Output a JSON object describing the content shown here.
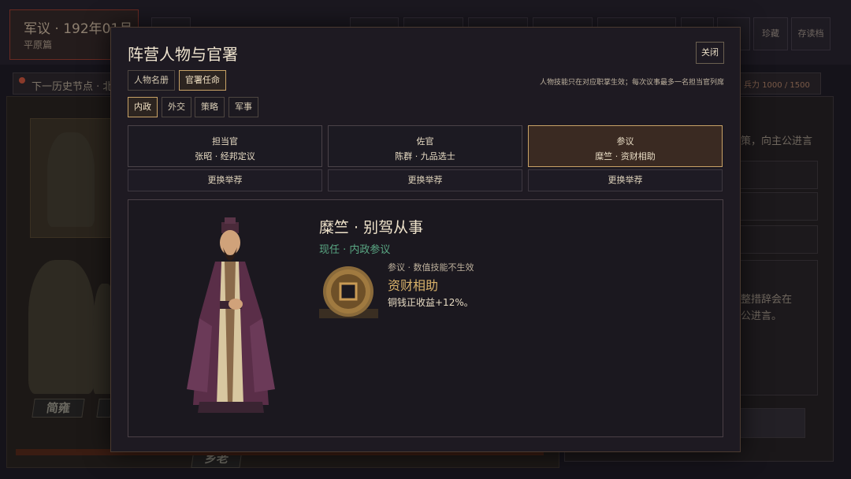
{
  "background": {
    "title": "军议 · 192年01月",
    "subtitle": "平原篇",
    "next_node": "下一历史节点 · 北",
    "troops_label": "兵力",
    "troops_value": "1000 / 1500",
    "buttons": [
      "珍藏",
      "存读档"
    ],
    "right_text_1": "策，向主公进言",
    "right_text_2": "整措辞会在",
    "right_text_3": "公进言。",
    "name_tags": [
      "简雍",
      "乡老"
    ]
  },
  "modal": {
    "title": "阵营人物与官署",
    "close_label": "关闭",
    "main_tabs": [
      {
        "label": "人物名册",
        "active": false
      },
      {
        "label": "官署任命",
        "active": true
      }
    ],
    "hint": "人物技能只在对应职掌生效；每次议事最多一名担当官列席",
    "sub_tabs": [
      {
        "label": "内政",
        "active": true
      },
      {
        "label": "外交",
        "active": false
      },
      {
        "label": "策略",
        "active": false
      },
      {
        "label": "军事",
        "active": false
      }
    ],
    "posts": [
      {
        "title": "担当官",
        "holder": "张昭 · 经邦定议",
        "active": false
      },
      {
        "title": "佐官",
        "holder": "陈群 · 九品选士",
        "active": false
      },
      {
        "title": "参议",
        "holder": "糜竺 · 资财相助",
        "active": true
      }
    ],
    "recommend_label": "更换举荐",
    "detail": {
      "name": "糜竺 · 别驾从事",
      "status": "现任 · 内政参议",
      "skill_note": "参议 · 数值技能不生效",
      "skill_name": "资财相助",
      "skill_effect": "铜钱正收益+12%。"
    }
  },
  "colors": {
    "accent_gold": "#c8a266",
    "status_green": "#5aa884",
    "skill_gold": "#d9b26a"
  }
}
